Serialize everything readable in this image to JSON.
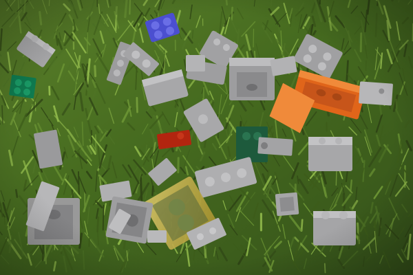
{
  "scene": {
    "kind": "photo",
    "subject": "lego-bricks-on-grass",
    "palette": {
      "grass_dark": "#2f4515",
      "grass_mid": "#4f7426",
      "grass_light": "#8fb84a",
      "brick_gray": "#9a9a9c",
      "brick_gray_light": "#c4c4c6",
      "brick_gray_dark": "#6e6e70",
      "brick_orange": "#e0651a",
      "brick_orange_light": "#f08a3a",
      "brick_green": "#0f7a4f",
      "brick_dark_green": "#1d5a3c",
      "brick_blue": "#4b4fd0",
      "brick_red": "#b2250f",
      "brick_tan": "#c9b45a"
    }
  }
}
